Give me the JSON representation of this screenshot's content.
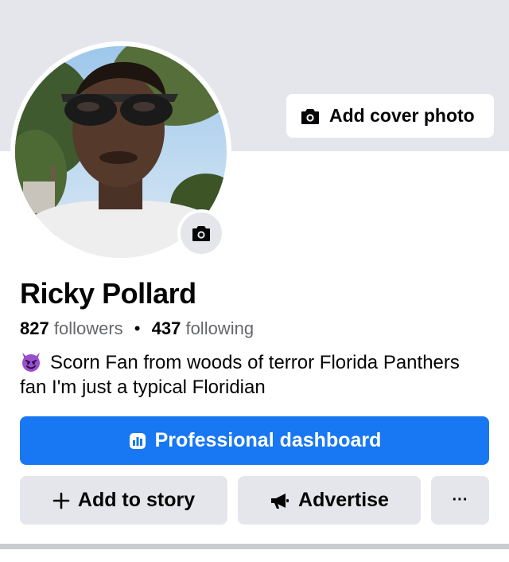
{
  "cover": {
    "add_cover_label": "Add cover photo"
  },
  "profile": {
    "name": "Ricky Pollard",
    "followers_count": "827",
    "followers_label": "followers",
    "separator": "•",
    "following_count": "437",
    "following_label": "following",
    "bio_emoji": "devil-emoji",
    "bio": "Scorn Fan from woods of terror Florida Panthers  fan I'm just a typical Floridian"
  },
  "actions": {
    "dashboard_label": "Professional dashboard",
    "add_story_label": "Add to story",
    "advertise_label": "Advertise",
    "more_label": "···"
  },
  "colors": {
    "primary": "#1877f2",
    "secondary_bg": "#e4e6eb",
    "muted_text": "#65676b"
  }
}
